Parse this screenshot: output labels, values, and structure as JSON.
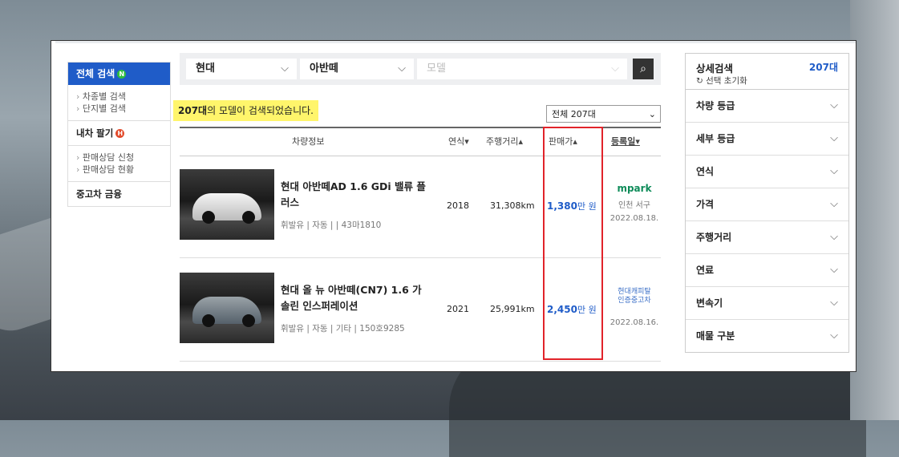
{
  "left_menu": {
    "active": "전체 검색",
    "active_badge": "N",
    "sub_items": [
      "차종별 검색",
      "단지별 검색"
    ],
    "sell": "내차 팔기",
    "sell_badge": "H",
    "sell_sub": [
      "판매상담 신청",
      "판매상담 현황"
    ],
    "finance": "중고차 금융"
  },
  "search": {
    "maker": "현대",
    "model": "아반떼",
    "detail_placeholder": "모델",
    "button_icon": "search-icon"
  },
  "result": {
    "count": "207대",
    "text": "의 모델이 검색되었습니다.",
    "filter": "전체 207대"
  },
  "table": {
    "headers": {
      "info": "차량정보",
      "year": "연식▾",
      "mileage": "주행거리▴",
      "price": "판매가▴",
      "date": "등록일▾"
    },
    "rows": [
      {
        "title": "현대 아반떼AD 1.6 GDi 밸류 플러스",
        "meta": "휘발유 | 자동 |  | 43마1810",
        "year": "2018",
        "mileage": "31,308km",
        "price": "1,380",
        "unit": "만 원",
        "dealer": "mpark",
        "location": "인천 서구",
        "date": "2022.08.18."
      },
      {
        "title": "현대 올 뉴 아반떼(CN7) 1.6 가솔린 인스퍼레이션",
        "meta": "휘발유 | 자동 | 기타 | 150호9285",
        "year": "2021",
        "mileage": "25,991km",
        "price": "2,450",
        "unit": "만 원",
        "dealer_line1": "현대캐피탈",
        "dealer_line2": "인증중고차",
        "date": "2022.08.16."
      }
    ]
  },
  "right_panel": {
    "title": "상세검색",
    "reset": "선택 초기화",
    "count": "207대",
    "items": [
      "차량 등급",
      "세부 등급",
      "연식",
      "가격",
      "주행거리",
      "연료",
      "변속기",
      "매물 구분"
    ]
  }
}
